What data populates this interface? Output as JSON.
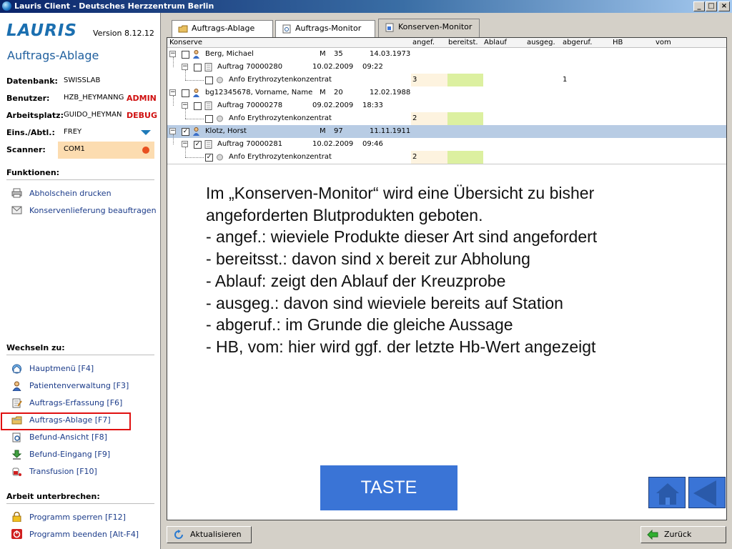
{
  "window": {
    "title": "Lauris Client - Deutsches Herzzentrum Berlin",
    "min": "_",
    "max": "□",
    "close": "×"
  },
  "sidebar": {
    "logo": "LAURIS",
    "version": "Version 8.12.12",
    "page_title": "Auftrags-Ablage",
    "info": {
      "datenbank_label": "Datenbank:",
      "datenbank_value": "SWISSLAB",
      "benutzer_label": "Benutzer:",
      "benutzer_value": "HZB_HEYMANNG",
      "benutzer_role": "ADMIN",
      "arbeitsplatz_label": "Arbeitsplatz:",
      "arbeitsplatz_value": "GUIDO_HEYMAN",
      "arbeitsplatz_mode": "DEBUG",
      "eins_label": "Eins./Abtl.:",
      "eins_value": "FREY",
      "scanner_label": "Scanner:",
      "scanner_value": "COM1"
    },
    "functions_title": "Funktionen:",
    "functions": [
      {
        "label": "Abholschein drucken",
        "icon": "printer-icon"
      },
      {
        "label": "Konservenlieferung beauftragen",
        "icon": "envelope-icon"
      }
    ],
    "switch_title": "Wechseln zu:",
    "switch_items": [
      {
        "label": "Hauptmenü [F4]",
        "icon": "home-globe-icon"
      },
      {
        "label": "Patientenverwaltung [F3]",
        "icon": "patient-icon"
      },
      {
        "label": "Auftrags-Erfassung [F6]",
        "icon": "form-edit-icon"
      },
      {
        "label": "Auftrags-Ablage [F7]",
        "icon": "folder-icon"
      },
      {
        "label": "Befund-Ansicht [F8]",
        "icon": "magnifier-document-icon"
      },
      {
        "label": "Befund-Eingang [F9]",
        "icon": "download-arrow-icon"
      },
      {
        "label": "Transfusion [F10]",
        "icon": "blood-bag-icon"
      }
    ],
    "interrupt_title": "Arbeit unterbrechen:",
    "interrupt_items": [
      {
        "label": "Programm sperren [F12]",
        "icon": "lock-icon"
      },
      {
        "label": "Programm beenden [Alt-F4]",
        "icon": "power-icon"
      }
    ]
  },
  "tabs": [
    {
      "label": "Auftrags-Ablage",
      "icon": "folder-icon"
    },
    {
      "label": "Auftrags-Monitor",
      "icon": "monitor-document-icon"
    },
    {
      "label": "Konserven-Monitor",
      "icon": "blood-document-icon"
    }
  ],
  "grid": {
    "columns": {
      "konserve": "Konserve",
      "angef": "angef.",
      "bereitst": "bereitst.",
      "ablauf": "Ablauf",
      "ausgeg": "ausgeg.",
      "abgeruf": "abgeruf.",
      "hb": "HB",
      "vom": "vom"
    },
    "rows": [
      {
        "name": "Berg,  Michael",
        "sex": "M",
        "age": "35",
        "dob": "14.03.1973",
        "order": {
          "label": "Auftrag 70000280",
          "date": "10.02.2009",
          "time": "09:22"
        },
        "product": {
          "label": "Anfo Erythrozytenkonzentrat",
          "angef": "3",
          "abgeruf": "1"
        }
      },
      {
        "name": "bg12345678,  Vorname, Name",
        "sex": "M",
        "age": "20",
        "dob": "12.02.1988",
        "order": {
          "label": "Auftrag 70000278",
          "date": "09.02.2009",
          "time": "18:33"
        },
        "product": {
          "label": "Anfo Erythrozytenkonzentrat",
          "angef": "2",
          "abgeruf": ""
        }
      },
      {
        "name": "Klotz,  Horst",
        "sex": "M",
        "age": "97",
        "dob": "11.11.1911",
        "order": {
          "label": "Auftrag 70000281",
          "date": "10.02.2009",
          "time": "09:46"
        },
        "product": {
          "label": "Anfo Erythrozytenkonzentrat",
          "angef": "2",
          "abgeruf": ""
        }
      }
    ]
  },
  "overlay_lines": [
    "Im „Konserven-Monitor“ wird eine Übersicht zu bisher",
    "angeforderten Blutprodukten geboten.",
    "- angef.: wieviele Produkte dieser Art sind angefordert",
    "- bereitsst.: davon sind x bereit zur Abholung",
    "- Ablauf: zeigt den Ablauf der Kreuzprobe",
    "- ausgeg.: davon sind wieviele bereits auf Station",
    "- abgeruf.: im Grunde die gleiche Aussage",
    "- HB, vom: hier wird ggf. der letzte Hb-Wert angezeigt"
  ],
  "taste_label": "TASTE",
  "buttons": {
    "refresh": "Aktualisieren",
    "back": "Zurück"
  },
  "colors": {
    "accent": "#1f5f9e",
    "selected_row": "#b8cce4",
    "overlay_button": "#3a74d6",
    "highlight": "#e01010"
  }
}
